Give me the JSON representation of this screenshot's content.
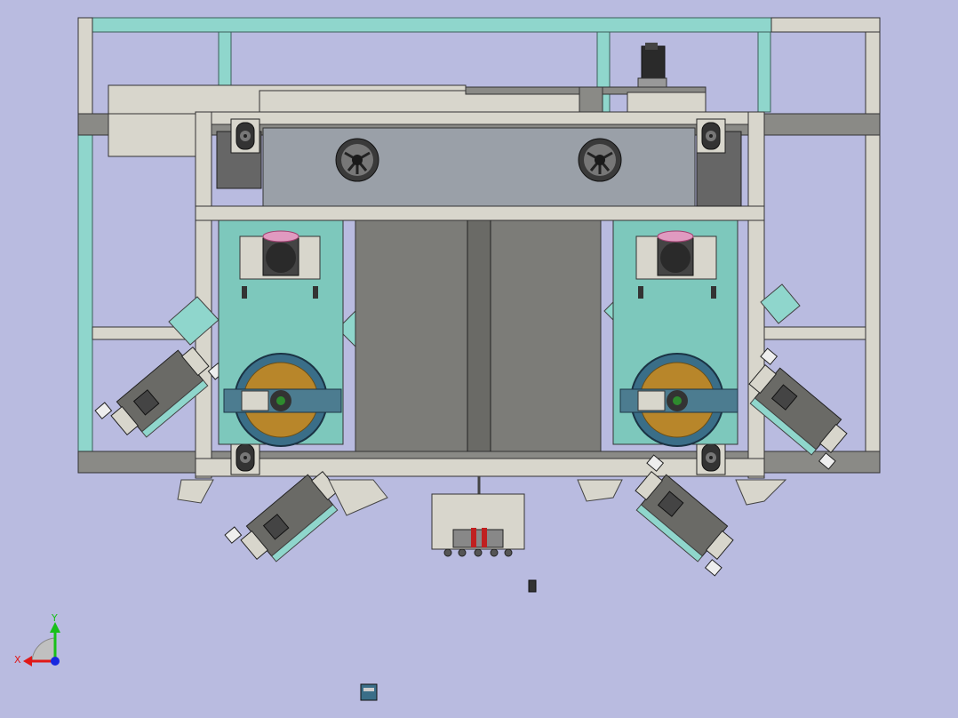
{
  "viewport": {
    "background": "#b9bbe0"
  },
  "colors": {
    "teal_frame": "#8fd6cc",
    "teal_edge": "#5a8f88",
    "gray_beam": "#8a8a86",
    "light_beige": "#d8d6cc",
    "panel_gray": "#9aa0a8",
    "dark_column": "#7c7c78",
    "teal_plate": "#7dc8bc",
    "wheel_gold": "#b8862a",
    "wheel_blue": "#3a6e88",
    "motor_dark": "#555555",
    "outline": "#222222"
  },
  "triad": {
    "x_label": "X",
    "y_label": "Y",
    "x_color": "#e01818",
    "y_color": "#18c018",
    "z_color": "#1828e0"
  },
  "icons": {
    "fans": [
      "fan-icon",
      "fan-icon"
    ],
    "caster_wheels": 4,
    "drive_wheels": 2
  }
}
